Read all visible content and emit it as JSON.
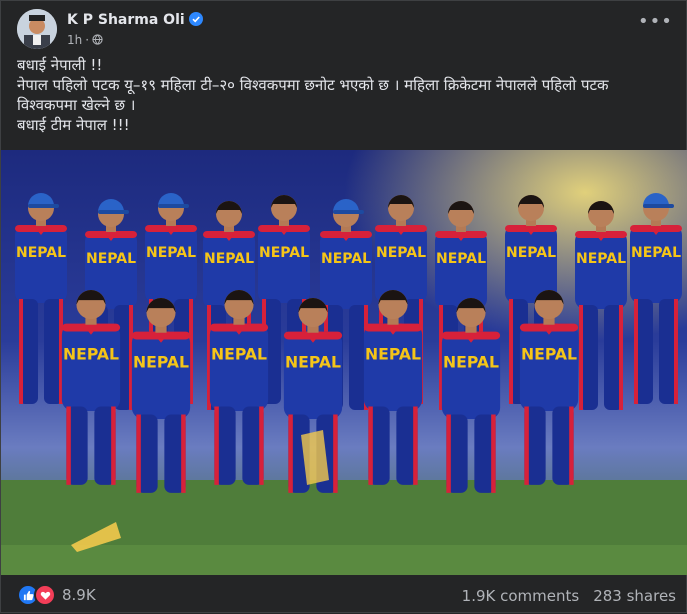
{
  "post": {
    "author": "K P Sharma Oli",
    "time": "1h",
    "privacy_icon": "globe-icon",
    "more_icon": "more-options-icon",
    "text_lines": [
      "बधाई नेपाली !!",
      "नेपाल पहिलो पटक यू–१९ महिला टी–२० विश्वकपमा छनोट भएको छ । महिला क्रिकेटमा नेपालले पहिलो पटक",
      "विश्वकपमा खेल्ने छ ।",
      "बधाई टीम नेपाल !!!"
    ],
    "jersey_text": "NEPAL"
  },
  "footer": {
    "reactions": "8.9K",
    "comments": "1.9K comments",
    "shares": "283 shares"
  },
  "colors": {
    "background": "#242526",
    "jersey": "#1f3aa8",
    "jersey_trim": "#d7213a",
    "jersey_text": "#f5c518",
    "like": "#2078f4",
    "love": "#f33e58"
  }
}
